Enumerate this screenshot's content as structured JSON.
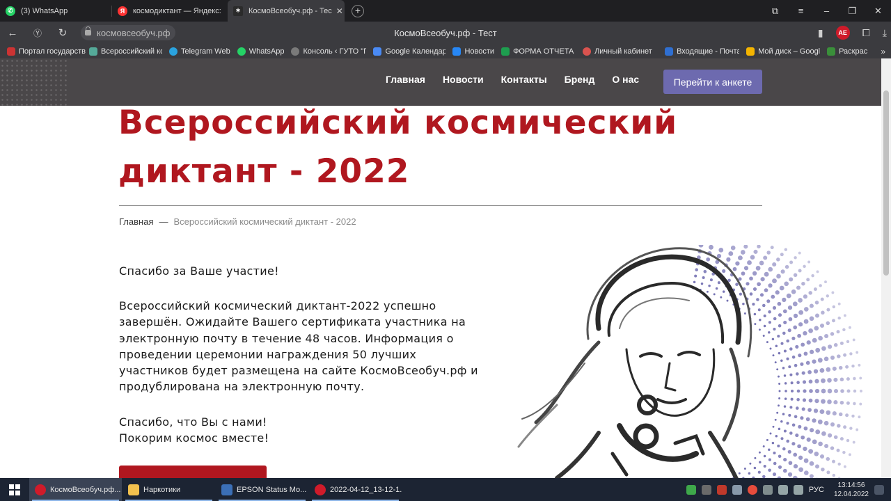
{
  "browser": {
    "tabs": [
      {
        "label": "(3) WhatsApp",
        "icon": "whatsapp-icon",
        "color": "#25d366",
        "active": false
      },
      {
        "label": "космодиктант — Яндекс:",
        "icon": "yandex-icon",
        "color": "#f33",
        "active": false
      },
      {
        "label": "КосмоВсеобуч.рф - Тес",
        "icon": "site-icon",
        "color": "#3a3a3a",
        "active": true
      }
    ],
    "url": "космовсеобуч.рф",
    "page_title": "КосмоВсеобуч.рф - Тест",
    "profile_badge": "AE",
    "bookmarks": [
      {
        "label": "Портал государств",
        "color": "#c33"
      },
      {
        "label": "Всероссийский ко",
        "color": "#5a9"
      },
      {
        "label": "Telegram Web",
        "color": "#2aa3df"
      },
      {
        "label": "WhatsApp",
        "color": "#25d366"
      },
      {
        "label": "Консоль ‹ ГУТО \"Г",
        "color": "#7a7a7a"
      },
      {
        "label": "Google Календарь",
        "color": "#4a8af4"
      },
      {
        "label": "Новости",
        "color": "#2787f5"
      },
      {
        "label": "ФОРМА ОТЧЕТА к",
        "color": "#1e9e4f"
      },
      {
        "label": "Личный кабинет",
        "color": "#d9534f"
      },
      {
        "label": "Входящие - Почта",
        "color": "#2f6fd1"
      },
      {
        "label": "Мой диск – Googl",
        "color": "#f4b400"
      },
      {
        "label": "Раскрас",
        "color": "#3a8f3a"
      }
    ]
  },
  "site": {
    "nav": [
      "Главная",
      "Новости",
      "Контакты",
      "Бренд",
      "О нас"
    ],
    "cta_label": "Перейти к анкете",
    "hero_line1": "Всероссийский космический",
    "hero_line2": "диктант - 2022",
    "breadcrumb_home": "Главная",
    "breadcrumb_sep": "—",
    "breadcrumb_current": "Всероссийский космический диктант - 2022",
    "thanks": "Спасибо за Ваше участие!",
    "paragraph_lines": [
      "Всероссийский космический диктант-2022 успешно",
      "завершён. Ожидайте Вашего сертификата участника на",
      "электронную почту в течение 48 часов. Информация о",
      "проведении церемонии награждения 50 лучших",
      "участников будет размещена на сайте КосмоВсеобуч.рф и",
      "продублирована на электронную почту."
    ],
    "closing_line1": "Спасибо, что Вы с нами!",
    "closing_line2": "Покорим космос вместе!",
    "accent_color": "#b0171f",
    "cta_color": "#6d6aaf"
  },
  "taskbar": {
    "tasks": [
      {
        "label": "КосмоВсеобуч.рф...",
        "color": "#d01b2a",
        "active": true
      },
      {
        "label": "Наркотики",
        "color": "#f2c14e",
        "active": false
      },
      {
        "label": "EPSON Status Mo...",
        "color": "#3b6fb6",
        "active": false
      },
      {
        "label": "2022-04-12_13-12-1...",
        "color": "#d01b2a",
        "active": false
      }
    ],
    "language": "РУС",
    "time": "13:14:56",
    "date": "12.04.2022"
  }
}
